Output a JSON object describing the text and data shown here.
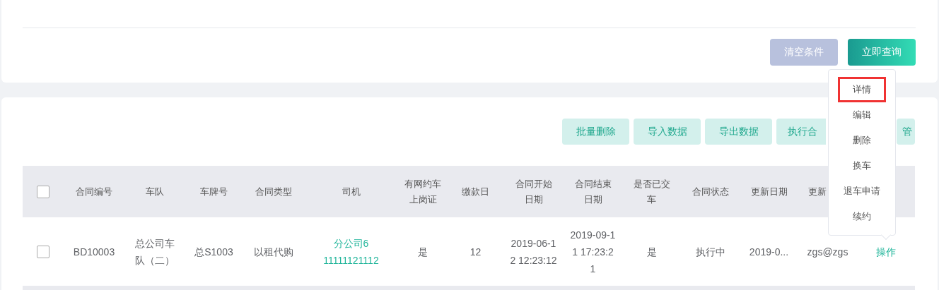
{
  "search_panel": {
    "buttons": [
      {
        "label": "清空条件",
        "kind": "reset"
      },
      {
        "label": "立即查询",
        "kind": "primary"
      }
    ]
  },
  "toolbar": {
    "buttons": [
      "批量删除",
      "导入数据",
      "导出数据",
      "执行合",
      "管"
    ]
  },
  "table": {
    "select_all": {
      "checked": false
    },
    "columns": [
      "合同编号",
      "车队",
      "车牌号",
      "合同类型",
      "司机",
      "有网约车上岗证",
      "缴款日",
      "合同开始日期",
      "合同结束日期",
      "是否已交车",
      "合同状态",
      "更新日期",
      "更新"
    ],
    "rows": [
      {
        "checked": false,
        "cells": [
          {
            "kind": "text",
            "text": "BD10003"
          },
          {
            "kind": "text",
            "text": "总公司车队（二）"
          },
          {
            "kind": "text",
            "text": "总S1003"
          },
          {
            "kind": "text",
            "text": "以租代购"
          },
          {
            "kind": "driver",
            "name": "分公司6",
            "phone": "11111121112"
          },
          {
            "kind": "text",
            "text": "是"
          },
          {
            "kind": "text",
            "text": "12"
          },
          {
            "kind": "text",
            "text": "2019-06-12 12:23:12"
          },
          {
            "kind": "text",
            "text": "2019-09-11 17:23:21"
          },
          {
            "kind": "text",
            "text": "是"
          },
          {
            "kind": "text",
            "text": "执行中"
          },
          {
            "kind": "text",
            "text": "2019-0..."
          },
          {
            "kind": "text",
            "text": "zgs@zgs"
          },
          {
            "kind": "link",
            "text": "操作"
          }
        ]
      }
    ]
  },
  "action_menu": {
    "items": [
      {
        "label": "详情",
        "highlighted": true
      },
      {
        "label": "编辑",
        "highlighted": false
      },
      {
        "label": "删除",
        "highlighted": false
      },
      {
        "label": "换车",
        "highlighted": false
      },
      {
        "label": "退车申请",
        "highlighted": false
      },
      {
        "label": "续约",
        "highlighted": false
      }
    ]
  }
}
